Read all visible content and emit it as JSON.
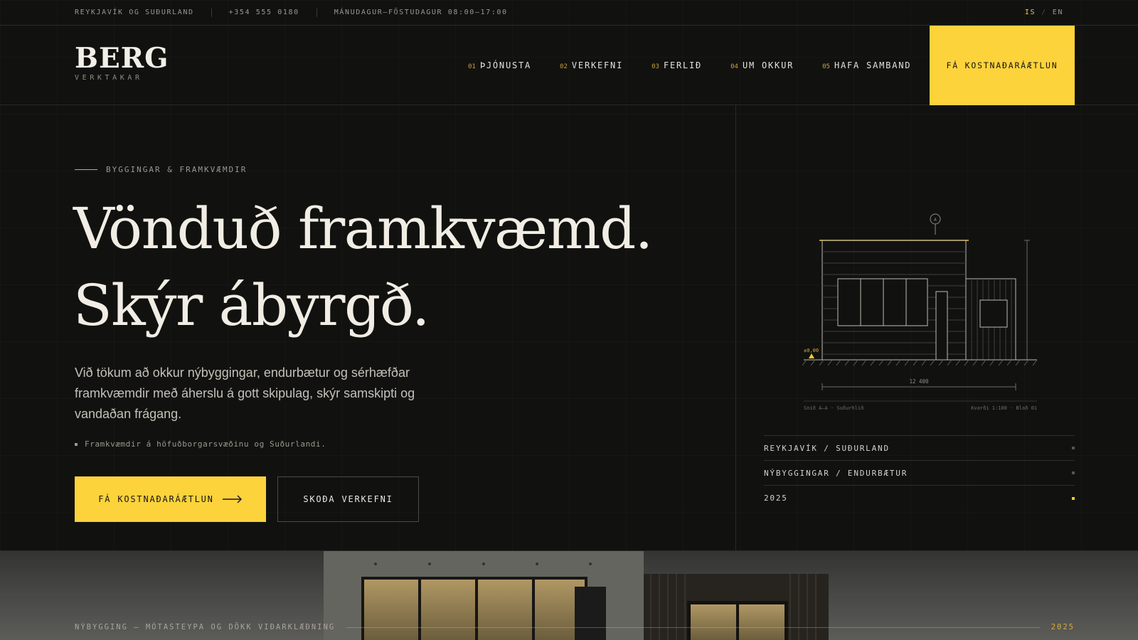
{
  "topbar": {
    "location": "REYKJAVÍK OG SUÐURLAND",
    "phone": "+354 555 0180",
    "hours": "MÁNUDAGUR–FÖSTUDAGUR 08:00–17:00",
    "lang_active": "IS",
    "lang_separator": "/",
    "lang_other": "EN"
  },
  "header": {
    "brand": "BERG",
    "brand_sub": "VERKTAKAR",
    "nav": [
      {
        "num": "01",
        "label": "ÞJÓNUSTA"
      },
      {
        "num": "02",
        "label": "VERKEFNI"
      },
      {
        "num": "03",
        "label": "FERLIÐ"
      },
      {
        "num": "04",
        "label": "UM OKKUR"
      },
      {
        "num": "05",
        "label": "HAFA SAMBAND"
      }
    ],
    "cta": "FÁ KOSTNAÐARÁÆTLUN"
  },
  "hero": {
    "eyebrow": "BYGGINGAR & FRAMKVÆMDIR",
    "headline_line1": "Vönduð framkvæmd.",
    "headline_line2": "Skýr ábyrgð.",
    "lead": "Við tökum að okkur nýbyggingar, endurbætur og sérhæfðar framkvæmdir með áherslu á gott skipulag, skýr samskipti og vandaðan frágang.",
    "note": "Framkvæmdir á höfuðborgarsvæðinu og Suðurlandi.",
    "primary_button": "FÁ KOSTNAÐARÁÆTLUN",
    "secondary_button": "SKOÐA VERKEFNI"
  },
  "drawing": {
    "marker": "A",
    "level": "±0,00",
    "dimension": "12 400",
    "section_label": "Snið A–A · Suðurhlið",
    "scale_label": "Kvarði 1:100 · Blað 01"
  },
  "info": [
    {
      "label": "REYKJAVÍK / SUÐURLAND"
    },
    {
      "label": "NÝBYGGINGAR / ENDURBÆTUR"
    },
    {
      "label": "2025"
    }
  ],
  "strip": {
    "caption": "NÝBYGGING — MÓTASTEYPA OG DÖKK VIÐARKLÆÐNING",
    "year": "2025"
  },
  "colors": {
    "accent": "#fdd33b",
    "background": "#111210",
    "text": "#f1ede4"
  },
  "icons": {
    "primary_button_icon": "arrow-right-icon"
  }
}
